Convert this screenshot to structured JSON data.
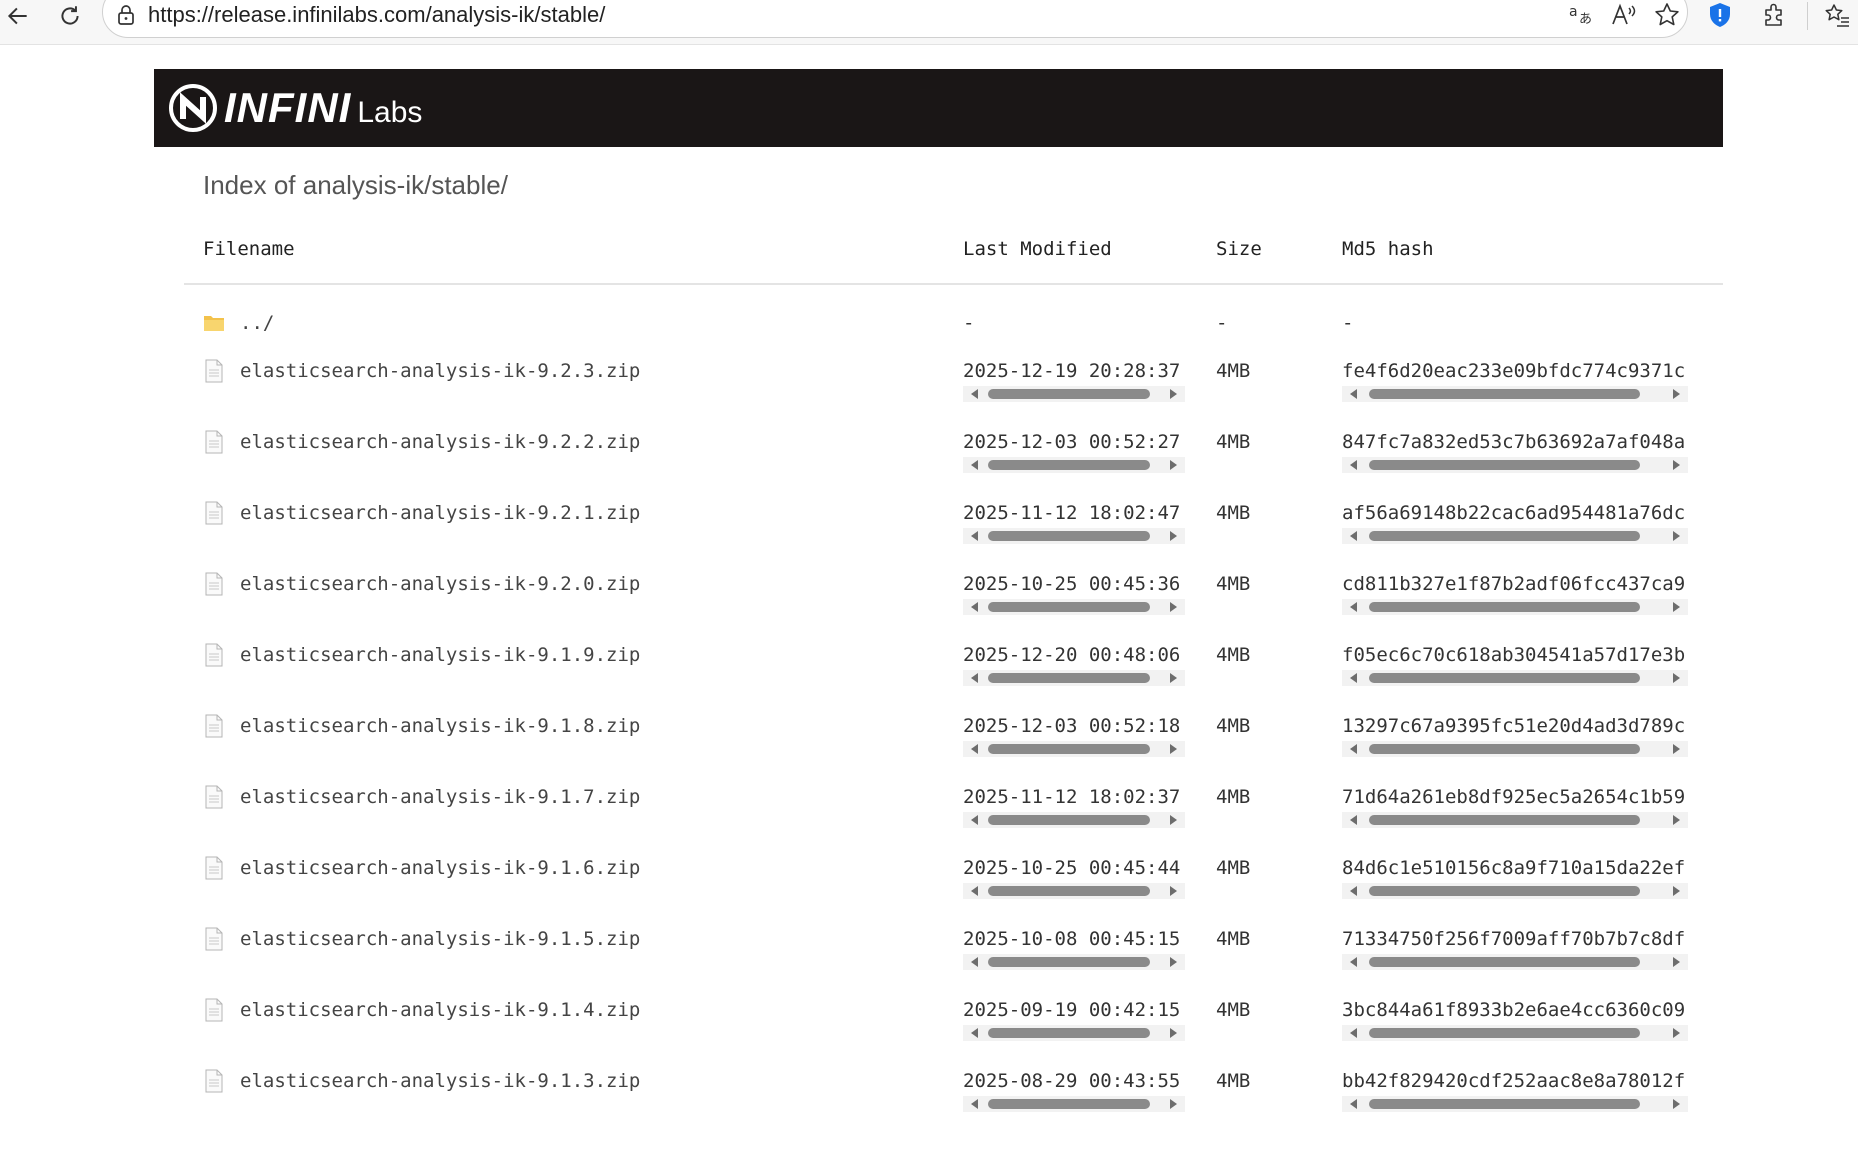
{
  "browser": {
    "url": "https://release.infinilabs.com/analysis-ik/stable/",
    "icons": [
      "back-icon",
      "reload-icon",
      "lock-icon",
      "translate-icon",
      "read-aloud-icon",
      "favorite-star-icon",
      "shield-icon",
      "extensions-icon",
      "favorites-list-icon"
    ],
    "accent_color": "#1a73e8"
  },
  "header": {
    "logo_infini": "INFINI",
    "logo_labs": "Labs",
    "background": "#1a1616"
  },
  "listing": {
    "title": "Index of analysis-ik/stable/",
    "columns": {
      "filename": "Filename",
      "last_modified": "Last Modified",
      "size": "Size",
      "md5": "Md5 hash"
    },
    "parent": {
      "name": "../",
      "modified": "-",
      "size": "-",
      "md5": "-"
    },
    "rows": [
      {
        "name": "elasticsearch-analysis-ik-9.2.3.zip",
        "modified": "2025-12-19 20:28:37",
        "size": "4MB",
        "md5": "fe4f6d20eac233e09bfdc774c9371c"
      },
      {
        "name": "elasticsearch-analysis-ik-9.2.2.zip",
        "modified": "2025-12-03 00:52:27",
        "size": "4MB",
        "md5": "847fc7a832ed53c7b63692a7af048a"
      },
      {
        "name": "elasticsearch-analysis-ik-9.2.1.zip",
        "modified": "2025-11-12 18:02:47",
        "size": "4MB",
        "md5": "af56a69148b22cac6ad954481a76dc"
      },
      {
        "name": "elasticsearch-analysis-ik-9.2.0.zip",
        "modified": "2025-10-25 00:45:36",
        "size": "4MB",
        "md5": "cd811b327e1f87b2adf06fcc437ca9"
      },
      {
        "name": "elasticsearch-analysis-ik-9.1.9.zip",
        "modified": "2025-12-20 00:48:06",
        "size": "4MB",
        "md5": "f05ec6c70c618ab304541a57d17e3b"
      },
      {
        "name": "elasticsearch-analysis-ik-9.1.8.zip",
        "modified": "2025-12-03 00:52:18",
        "size": "4MB",
        "md5": "13297c67a9395fc51e20d4ad3d789c"
      },
      {
        "name": "elasticsearch-analysis-ik-9.1.7.zip",
        "modified": "2025-11-12 18:02:37",
        "size": "4MB",
        "md5": "71d64a261eb8df925ec5a2654c1b59"
      },
      {
        "name": "elasticsearch-analysis-ik-9.1.6.zip",
        "modified": "2025-10-25 00:45:44",
        "size": "4MB",
        "md5": "84d6c1e510156c8a9f710a15da22ef"
      },
      {
        "name": "elasticsearch-analysis-ik-9.1.5.zip",
        "modified": "2025-10-08 00:45:15",
        "size": "4MB",
        "md5": "71334750f256f7009aff70b7b7c8df"
      },
      {
        "name": "elasticsearch-analysis-ik-9.1.4.zip",
        "modified": "2025-09-19 00:42:15",
        "size": "4MB",
        "md5": "3bc844a61f8933b2e6ae4cc6360c09"
      },
      {
        "name": "elasticsearch-analysis-ik-9.1.3.zip",
        "modified": "2025-08-29 00:43:55",
        "size": "4MB",
        "md5": "bb42f829420cdf252aac8e8a78012f"
      }
    ]
  }
}
